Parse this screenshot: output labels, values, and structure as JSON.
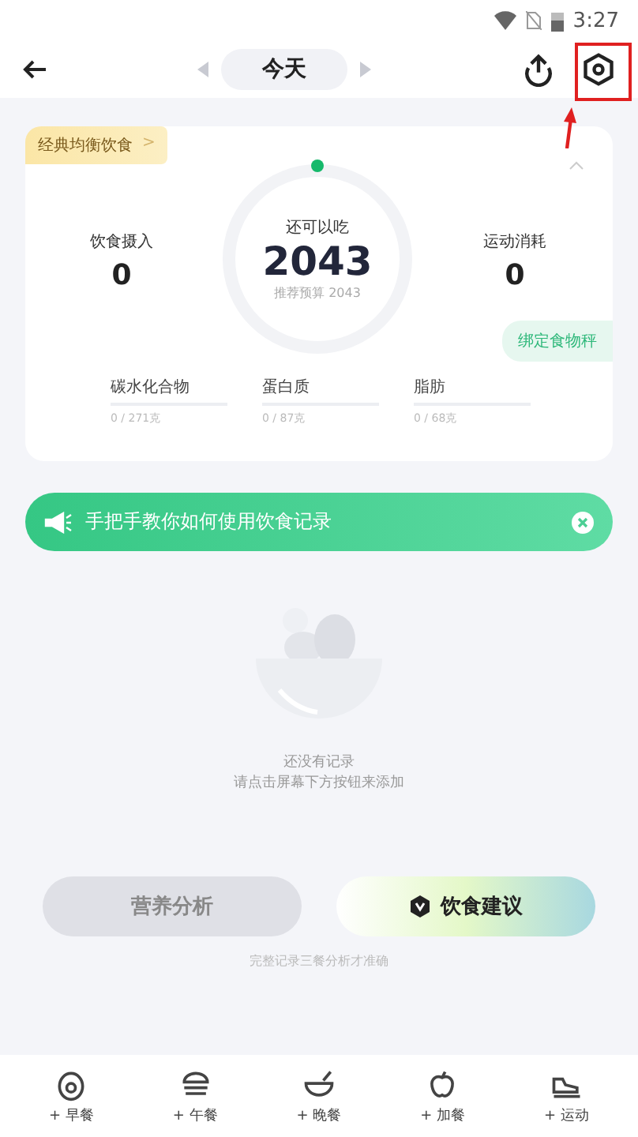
{
  "status_bar": {
    "time": "3:27"
  },
  "header": {
    "date": "今天"
  },
  "summary": {
    "plan_tag": "经典均衡饮食",
    "plan_chevron": ">",
    "center_label": "还可以吃",
    "center_value": "2043",
    "center_sub": "推荐预算 2043",
    "left": {
      "label": "饮食摄入",
      "value": "0"
    },
    "right": {
      "label": "运动消耗",
      "value": "0"
    },
    "bind_button": "绑定食物秤",
    "macros": [
      {
        "name": "碳水化合物",
        "amount": "0 / 271克"
      },
      {
        "name": "蛋白质",
        "amount": "0 / 87克"
      },
      {
        "name": "脂肪",
        "amount": "0 / 68克"
      }
    ]
  },
  "banner": {
    "text": "手把手教你如何使用饮食记录"
  },
  "empty_state": {
    "lines": [
      "还没有记录",
      "请点击屏幕下方按钮来添加"
    ]
  },
  "actions": [
    {
      "label": "营养分析",
      "kind": "plain"
    },
    {
      "label": "饮食建议",
      "kind": "featured"
    }
  ],
  "hint": "完整记录三餐分析才准确",
  "bottom_nav": [
    {
      "label": "+ 早餐",
      "kind": "egg"
    },
    {
      "label": "+ 午餐",
      "kind": "burger"
    },
    {
      "label": "+ 晚餐",
      "kind": "bowl"
    },
    {
      "label": "+ 加餐",
      "kind": "apple"
    },
    {
      "label": "+ 运动",
      "kind": "shoe"
    }
  ]
}
